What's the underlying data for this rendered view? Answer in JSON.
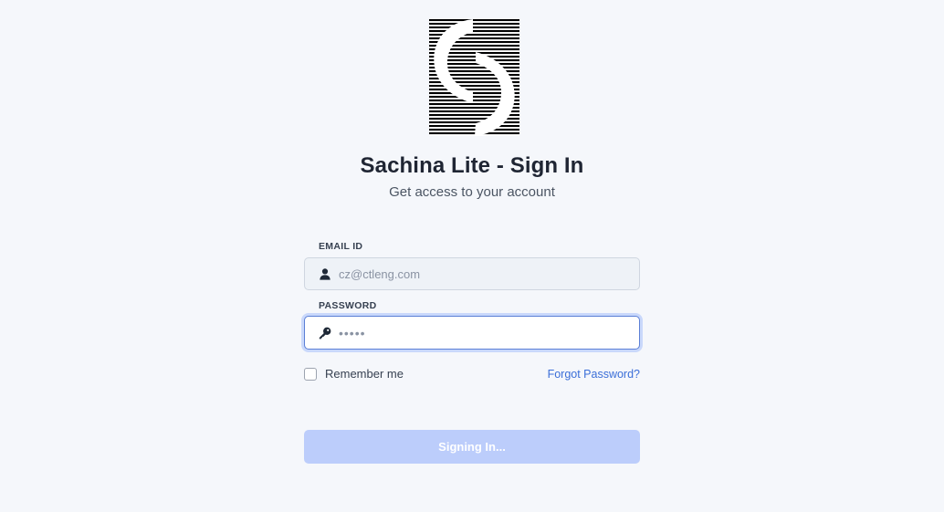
{
  "app": {
    "title": "Sachina Lite - Sign In",
    "subtitle": "Get access to your account"
  },
  "logo": {
    "name": "sachina-logo",
    "colors": [
      "#000000",
      "#ffffff"
    ]
  },
  "form": {
    "email": {
      "label": "EMAIL ID",
      "value": "",
      "placeholder": "cz@ctleng.com",
      "icon": "user-icon"
    },
    "password": {
      "label": "PASSWORD",
      "value": "",
      "placeholder": "•••••",
      "icon": "key-icon"
    },
    "remember_label": "Remember me",
    "remember_checked": false,
    "forgot_label": "Forgot Password?",
    "submit_label": "Signing In..."
  },
  "colors": {
    "background": "#f5f7fb",
    "accent": "#3b6fd8",
    "focus_ring": "#c9d8fb",
    "button_disabled": "#bccdfb"
  }
}
